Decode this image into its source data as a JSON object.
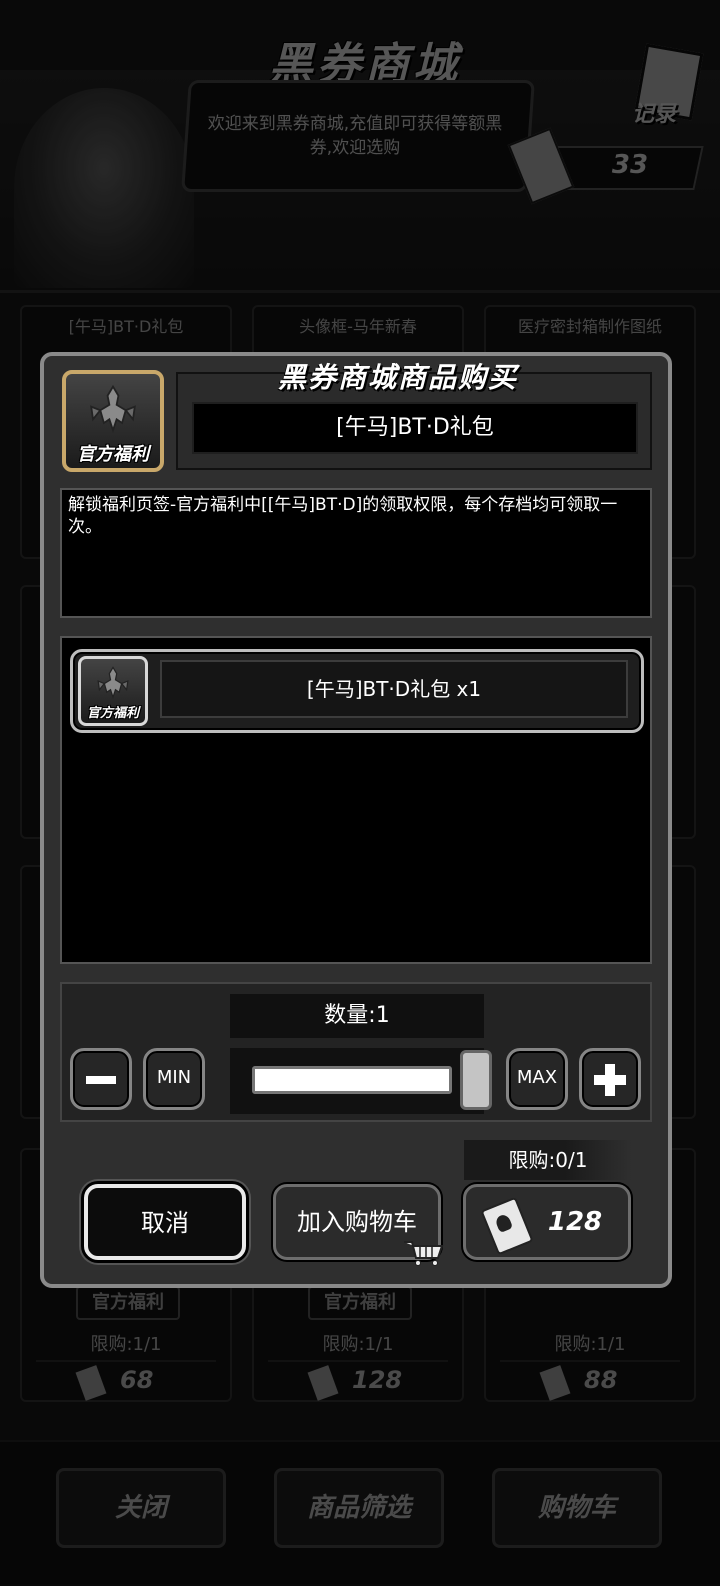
{
  "background": {
    "header_title": "黑券商城",
    "welcome_text": "欢迎来到黑券商城,充值即可获得等额黑券,欢迎选购",
    "records_label": "记录",
    "balance": "33",
    "cards_top": [
      "[午马]BT·D礼包",
      "头像框-马年新春",
      "医疗密封箱制作图纸"
    ],
    "cards_bottom": [
      {
        "badge": "官方福利",
        "limit": "限购:1/1",
        "price": "68"
      },
      {
        "badge": "官方福利",
        "limit": "限购:1/1",
        "price": "128"
      },
      {
        "badge": "",
        "limit": "限购:1/1",
        "price": "88"
      }
    ],
    "bottom_buttons": {
      "close": "关闭",
      "filter": "商品筛选",
      "cart": "购物车"
    }
  },
  "dialog": {
    "title": "黑券商城商品购买",
    "item_badge": "官方福利",
    "item_name": "[午马]BT·D礼包",
    "description": "解锁福利页签-官方福利中[[午马]BT·D]的领取权限，每个存档均可领取一次。",
    "contents": [
      {
        "badge": "官方福利",
        "label": "[午马]BT·D礼包 x1"
      }
    ],
    "quantity_label": "数量:1",
    "quantity_fraction": 1,
    "min_label": "MIN",
    "max_label": "MAX",
    "limit_text": "限购:0/1",
    "cancel_label": "取消",
    "add_to_cart_label": "加入购物车",
    "price": "128"
  },
  "colors": {
    "modal_border": "#8a8a8a",
    "gold_frame": "#c9a86a"
  }
}
